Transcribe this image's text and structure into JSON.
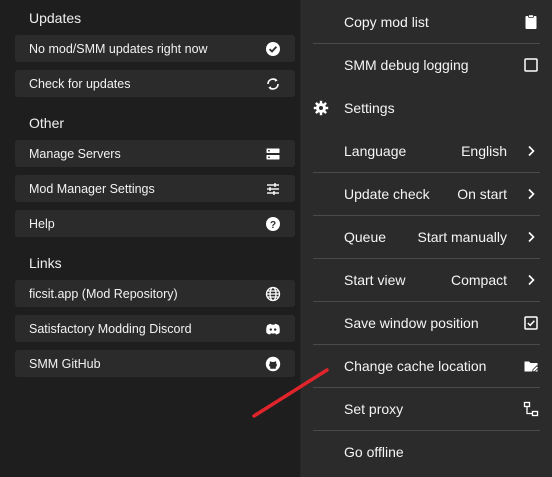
{
  "sidebar": {
    "sections": [
      {
        "title": "Updates",
        "items": [
          {
            "label": "No mod/SMM updates right now",
            "icon": "check-circle-icon"
          },
          {
            "label": "Check for updates",
            "icon": "sync-icon"
          }
        ]
      },
      {
        "title": "Other",
        "items": [
          {
            "label": "Manage Servers",
            "icon": "server-icon"
          },
          {
            "label": "Mod Manager Settings",
            "icon": "tune-icon"
          },
          {
            "label": "Help",
            "icon": "help-circle-icon"
          }
        ]
      },
      {
        "title": "Links",
        "items": [
          {
            "label": "ficsit.app (Mod Repository)",
            "icon": "globe-icon"
          },
          {
            "label": "Satisfactory Modding Discord",
            "icon": "discord-icon"
          },
          {
            "label": "SMM GitHub",
            "icon": "github-icon"
          }
        ]
      }
    ]
  },
  "menu": {
    "items": [
      {
        "label": "Copy mod list",
        "icon": "clipboard-icon"
      },
      {
        "label": "SMM debug logging",
        "icon": "checkbox-unchecked-icon"
      },
      {
        "label": "Settings",
        "icon": "gear-icon"
      },
      {
        "label": "Language",
        "value": "English",
        "icon": "chevron-right-icon"
      },
      {
        "label": "Update check",
        "value": "On start",
        "icon": "chevron-right-icon"
      },
      {
        "label": "Queue",
        "value": "Start manually",
        "icon": "chevron-right-icon"
      },
      {
        "label": "Start view",
        "value": "Compact",
        "icon": "chevron-right-icon"
      },
      {
        "label": "Save window position",
        "icon": "checkbox-checked-icon"
      },
      {
        "label": "Change cache location",
        "icon": "folder-edit-icon"
      },
      {
        "label": "Set proxy",
        "icon": "network-icon"
      },
      {
        "label": "Go offline"
      }
    ]
  },
  "colors": {
    "sidebar_bg": "#1e1e1e",
    "item_bg": "#2b2b2b",
    "menu_bg": "#2b2b2b",
    "annotation_arrow": "#e0242b"
  }
}
